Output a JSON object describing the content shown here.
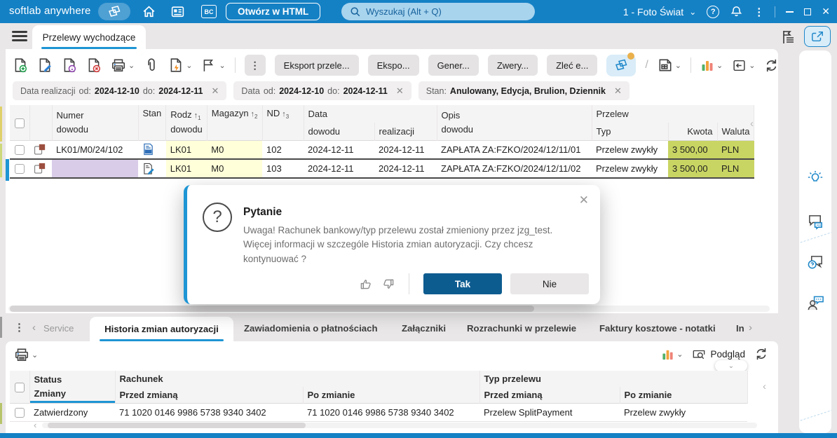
{
  "colors": {
    "accent": "#1581c5",
    "tab_underline": "#1e95d4",
    "yes_button": "#0d5c90",
    "cell_yellow": "#ffffd9",
    "cell_green": "#c9d563",
    "cell_purple": "#d8cce8"
  },
  "icons": {
    "kebab": "⋮",
    "chevron_down": "⌄",
    "chevron_left": "‹",
    "chevron_right": "›",
    "close": "✕",
    "slash": "/",
    "sort_arrow": "↑",
    "question_mark": "?",
    "bc_label": "BC"
  },
  "topbar": {
    "brand": "softlab anywhere",
    "open_html": "Otwórz w HTML",
    "search_placeholder": "Wyszukaj (Alt + Q)",
    "company": "1 - Foto Świat"
  },
  "page": {
    "tab": "Przelewy wychodzące"
  },
  "toolbar": {
    "export1": "Eksport przele...",
    "export2": "Ekspo...",
    "generate": "Gener...",
    "verify": "Zwery...",
    "order": "Zleć e..."
  },
  "filters": {
    "f1": {
      "label": "Data realizacji",
      "od_label": "od:",
      "od": "2024-12-10",
      "do_label": "do:",
      "do": "2024-12-11"
    },
    "f2": {
      "label": "Data",
      "od_label": "od:",
      "od": "2024-12-10",
      "do_label": "do:",
      "do": "2024-12-11"
    },
    "f3": {
      "label": "Stan:",
      "value": "Anulowany, Edycja, Brulion, Dziennik"
    }
  },
  "grid": {
    "headers": {
      "numer_l1": "Numer",
      "numer_l2": "dowodu",
      "stan": "Stan",
      "rodz_l1": "Rodz",
      "rodz_l2": "dowodu",
      "magazyn": "Magazyn",
      "nd": "ND",
      "data_group": "Data",
      "data_sub1": "dowodu",
      "data_sub2": "realizacji",
      "opis_l1": "Opis",
      "opis_l2": "dowodu",
      "przelew_group": "Przelew",
      "typ": "Typ",
      "kwota": "Kwota",
      "waluta": "Waluta"
    },
    "sort_orders": [
      "1",
      "2",
      "3"
    ],
    "rows": [
      {
        "numer": "LK01/M0/24/102",
        "rodz": "LK01",
        "magazyn": "M0",
        "nd": "102",
        "data_dowodu": "2024-12-11",
        "data_realizacji": "2024-12-11",
        "opis": "ZAPŁATA ZA:FZKO/2024/12/11/01",
        "typ": "Przelew zwykły",
        "kwota": "3 500,00",
        "waluta": "PLN"
      },
      {
        "numer": "",
        "rodz": "LK01",
        "magazyn": "M0",
        "nd": "103",
        "data_dowodu": "2024-12-11",
        "data_realizacji": "2024-12-11",
        "opis": "ZAPŁATA ZA:FZKO/2024/12/11/02",
        "typ": "Przelew zwykły",
        "kwota": "3 500,00",
        "waluta": "PLN"
      }
    ]
  },
  "dialog": {
    "title": "Pytanie",
    "message": "Uwaga! Rachunek bankowy/typ przelewu został zmieniony przez jzg_test. Więcej informacji w szczególe Historia zmian autoryzacji. Czy chcesz kontynuować ?",
    "yes": "Tak",
    "no": "Nie"
  },
  "bottom_tabs": {
    "service": "Service",
    "history": "Historia zmian autoryzacji",
    "notifications": "Zawiadomienia o płatnościach",
    "attachments": "Załączniki",
    "settlements": "Rozrachunki w przelewie",
    "invoices": "Faktury kosztowe - notatki",
    "more": "In"
  },
  "bottom_toolbar": {
    "preview": "Podgląd"
  },
  "history": {
    "headers": {
      "status_l1": "Status",
      "status_l2": "Zmiany",
      "rachunek": "Rachunek",
      "przed1": "Przed zmianą",
      "po1": "Po zmianie",
      "typ": "Typ przelewu",
      "przed2": "Przed zmianą",
      "po2": "Po zmianie"
    },
    "rows": [
      {
        "status": "Zatwierdzony",
        "rachunek_przed": "71 1020 0146 9986 5738 9340 3402",
        "rachunek_po": "71 1020 0146 9986 5738 9340 3402",
        "typ_przed": "Przelew SplitPayment",
        "typ_po": "Przelew zwykły"
      }
    ]
  }
}
